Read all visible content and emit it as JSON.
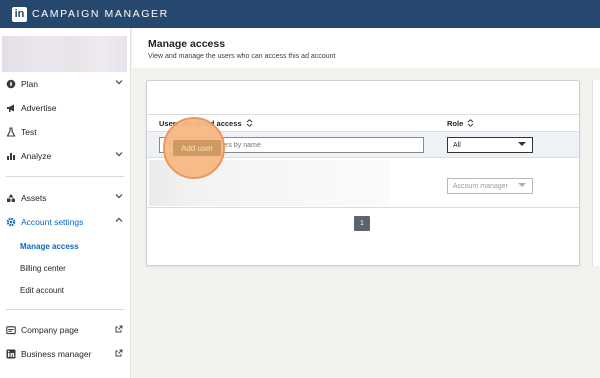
{
  "topbar": {
    "brand": "CAMPAIGN MANAGER",
    "logo_text": "in"
  },
  "sidebar": {
    "items": [
      {
        "label": "Plan",
        "icon": "compass-icon"
      },
      {
        "label": "Advertise",
        "icon": "megaphone-icon"
      },
      {
        "label": "Test",
        "icon": "flask-icon"
      },
      {
        "label": "Analyze",
        "icon": "bar-chart-icon"
      },
      {
        "label": "Assets",
        "icon": "shapes-icon"
      },
      {
        "label": "Account settings",
        "icon": "gear-icon"
      },
      {
        "label": "Company page",
        "icon": "company-page-icon"
      },
      {
        "label": "Business manager",
        "icon": "linkedin-icon"
      }
    ],
    "subitems": [
      {
        "label": "Manage access",
        "active": true
      },
      {
        "label": "Billing center",
        "active": false
      },
      {
        "label": "Edit account",
        "active": false
      }
    ]
  },
  "header": {
    "title": "Manage access",
    "subtitle": "View and manage the users who can access this ad account"
  },
  "card": {
    "add_user_label": "Add user",
    "columns": {
      "users": "Users assigned access",
      "role": "Role"
    },
    "search_placeholder": "Search existing users by name",
    "role_filter_value": "All",
    "row_role_value": "Account manager",
    "page_number": "1"
  },
  "colors": {
    "topbar": "#27486e",
    "accent": "#0a66c2",
    "highlight": "#f7b983"
  }
}
